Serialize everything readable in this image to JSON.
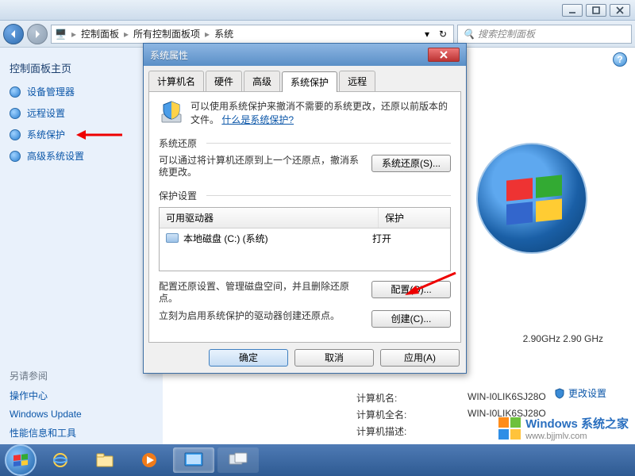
{
  "window": {
    "min": "—",
    "max": "▢",
    "close": "✕"
  },
  "nav": {
    "crumbs": [
      "控制面板",
      "所有控制面板项",
      "系统"
    ],
    "search_placeholder": "搜索控制面板"
  },
  "sidebar": {
    "title": "控制面板主页",
    "links": [
      "设备管理器",
      "远程设置",
      "系统保护",
      "高级系统设置"
    ],
    "see_also_title": "另请参阅",
    "see_also": [
      "操作中心",
      "Windows Update",
      "性能信息和工具"
    ]
  },
  "content": {
    "cpu_line": "2.90GHz   2.90 GHz",
    "change_link": "更改设置",
    "rows": [
      {
        "label": "计算机名:",
        "value": "WIN-I0LIK6SJ28O"
      },
      {
        "label": "计算机全名:",
        "value": "WIN-I0LIK6SJ28O"
      },
      {
        "label": "计算机描述:",
        "value": ""
      }
    ]
  },
  "dialog": {
    "title": "系统属性",
    "tabs": [
      "计算机名",
      "硬件",
      "高级",
      "系统保护",
      "远程"
    ],
    "active_tab": 3,
    "intro_line1": "可以使用系统保护来撤消不需要的系统更改，还原以前版本的文件。",
    "intro_link": "什么是系统保护?",
    "restore_group": "系统还原",
    "restore_text": "可以通过将计算机还原到上一个还原点，撤消系统更改。",
    "restore_btn": "系统还原(S)...",
    "protect_group": "保护设置",
    "table_headers": [
      "可用驱动器",
      "保护"
    ],
    "table_row": {
      "drive": "本地磁盘 (C:) (系统)",
      "status": "打开"
    },
    "config_text": "配置还原设置、管理磁盘空间，并且删除还原点。",
    "config_btn": "配置(O)...",
    "create_text": "立刻为启用系统保护的驱动器创建还原点。",
    "create_btn": "创建(C)...",
    "ok": "确定",
    "cancel": "取消",
    "apply": "应用(A)"
  },
  "watermark": {
    "brand": "Windows 系统之家",
    "site": "www.bjjmlv.com"
  }
}
